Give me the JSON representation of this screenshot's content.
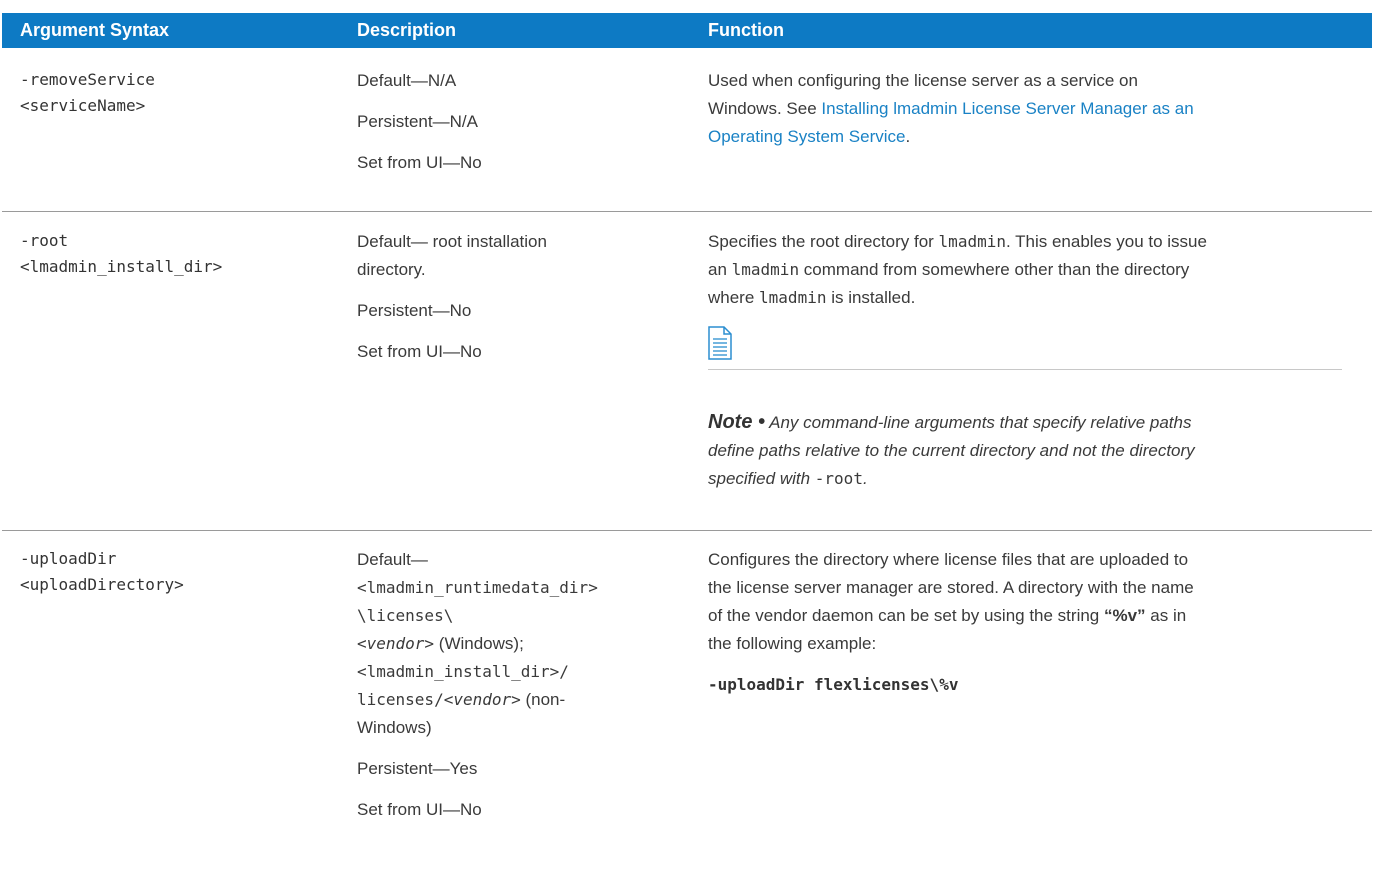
{
  "colors": {
    "header_bg": "#0d7ac4",
    "header_text": "#ffffff",
    "link": "#1a82c5",
    "divider": "#9a9a9a"
  },
  "header": {
    "col1": "Argument Syntax",
    "col2": "Description",
    "col3": "Function"
  },
  "rows": [
    {
      "syntax": [
        "-removeService",
        "<serviceName>"
      ],
      "description": [
        "Default—N/A",
        "Persistent—N/A",
        "Set from UI—No"
      ],
      "function": {
        "text1": "Used when configuring the license server as a service on",
        "text2": "Windows. See ",
        "link": "Installing lmadmin License Server Manager as an Operating System Service",
        "link_line1": "Installing lmadmin License Server Manager as an",
        "link_line2": "Operating System Service",
        "text3": "."
      }
    },
    {
      "syntax": [
        "-root",
        "<lmadmin_install_dir>"
      ],
      "description": {
        "default_l1": "Default— root installation",
        "default_l2": "directory.",
        "persistent": "Persistent—No",
        "set_from_ui": "Set from UI—No"
      },
      "function": {
        "l1_a": "Specifies the root directory for ",
        "l1_code": "lmadmin",
        "l1_b": ". This enables you to issue",
        "l2_a": "an ",
        "l2_code": "lmadmin",
        "l2_b": " command from somewhere other than the directory",
        "l3_a": "where ",
        "l3_code": "lmadmin",
        "l3_b": " is installed.",
        "note_icon": "note-document-icon",
        "note_label": "Note •",
        "note_l1": " Any command-line arguments that specify relative paths",
        "note_l2": "define paths relative to the current directory and not the directory",
        "note_l3_a": "specified with ",
        "note_l3_code": "-root",
        "note_l3_b": "."
      }
    },
    {
      "syntax": [
        "-uploadDir",
        "<uploadDirectory>"
      ],
      "description": {
        "l1": "Default—",
        "l2": "<lmadmin_runtimedata_dir>",
        "l3": "\\licenses\\",
        "l4_var": "<vendor>",
        "l4_rest": " (Windows);",
        "l5": "<lmadmin_install_dir>/",
        "l6_a": "licenses/",
        "l6_var": "<vendor>",
        "l6_b": " (non-",
        "l7": "Windows)",
        "persistent": "Persistent—Yes",
        "set_from_ui": "Set from UI—No"
      },
      "function": {
        "l1": "Configures the directory where license files that are uploaded to",
        "l2": "the license server manager are stored. A directory with the name",
        "l3_a": "of the vendor daemon can be set by using the string ",
        "l3_b": "“%v”",
        "l3_c": " as in",
        "l4": "the following example:",
        "example": "-uploadDir flexlicenses\\%v"
      }
    }
  ]
}
